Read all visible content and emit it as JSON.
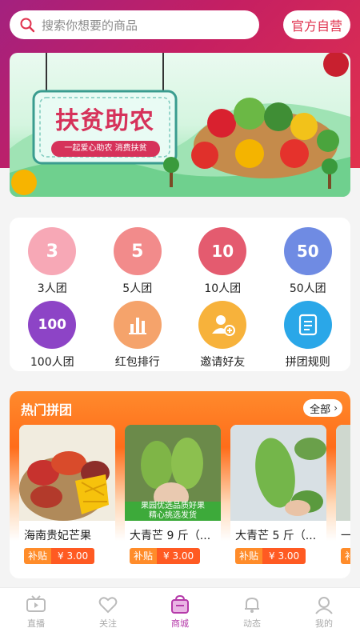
{
  "search": {
    "placeholder": "搜索你想要的商品",
    "official_label": "官方自营"
  },
  "banner": {
    "title": "扶贫助农",
    "subtitle": "一起爱心助农 消费扶贫"
  },
  "grid": {
    "items": [
      {
        "label": "3人团",
        "icon_text": "3",
        "icon": "group-3-icon",
        "color": "#f7a8b6"
      },
      {
        "label": "5人团",
        "icon_text": "5",
        "icon": "group-5-icon",
        "color": "#f28b8b"
      },
      {
        "label": "10人团",
        "icon_text": "10",
        "icon": "group-10-icon",
        "color": "#e45b6f"
      },
      {
        "label": "50人团",
        "icon_text": "50",
        "icon": "group-50-icon",
        "color": "#6f8be3"
      },
      {
        "label": "100人团",
        "icon_text": "100",
        "icon": "group-100-icon",
        "color": "#8d44c6"
      },
      {
        "label": "红包排行",
        "icon_text": "",
        "icon": "bar-chart-icon",
        "color": "#f5a36b"
      },
      {
        "label": "邀请好友",
        "icon_text": "",
        "icon": "invite-user-icon",
        "color": "#f7b23b"
      },
      {
        "label": "拼团规则",
        "icon_text": "",
        "icon": "rules-doc-icon",
        "color": "#2aa7e8"
      }
    ]
  },
  "hot": {
    "title": "热门拼团",
    "all_label": "全部",
    "products": [
      {
        "name": "海南贵妃芒果",
        "tag": "补贴",
        "price": "¥ 3.00"
      },
      {
        "name": "大青芒 9 斤（...",
        "tag": "补贴",
        "price": "¥ 3.00",
        "overlay": "果园优选品质好果\n精心挑选发货"
      },
      {
        "name": "大青芒 5 斤（...",
        "tag": "补贴",
        "price": "¥ 3.00"
      },
      {
        "name": "一",
        "tag": "补",
        "price": ""
      }
    ]
  },
  "tabs": [
    {
      "label": "直播",
      "icon": "live-tv-icon"
    },
    {
      "label": "关注",
      "icon": "heart-icon"
    },
    {
      "label": "商城",
      "icon": "shop-bag-icon",
      "active": true
    },
    {
      "label": "动态",
      "icon": "bell-icon"
    },
    {
      "label": "我的",
      "icon": "profile-icon"
    }
  ],
  "colors": {
    "accent": "#c51f62",
    "hot": "#ff6d1a",
    "active_tab": "#b53aa9"
  }
}
